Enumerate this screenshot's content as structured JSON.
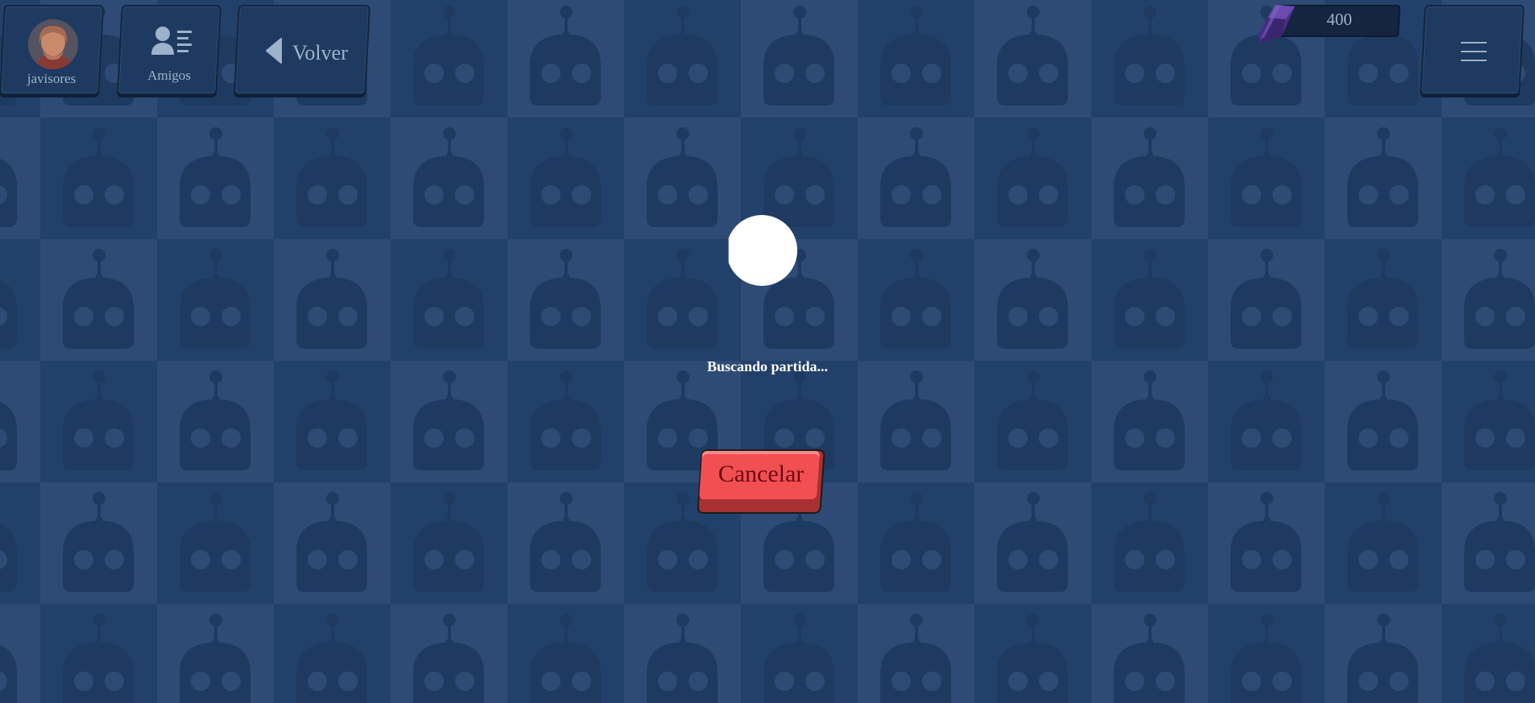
{
  "header": {
    "profile": {
      "username": "javisores"
    },
    "friends": {
      "label": "Amigos"
    },
    "back": {
      "label": "Volver"
    },
    "currency": {
      "amount": "400",
      "icon": "gem-icon"
    },
    "menu": {
      "icon": "hamburger-menu-icon"
    }
  },
  "matchmaking": {
    "status_text": "Buscando partida...",
    "cancel_label": "Cancelar"
  },
  "colors": {
    "background_dark": "#22416a",
    "background_light": "#2d4b75",
    "robot_pattern": "#1f3a61",
    "cancel_button": "#f24f53",
    "cancel_text": "#6a0a0e",
    "gem": "#5b3a9a"
  }
}
